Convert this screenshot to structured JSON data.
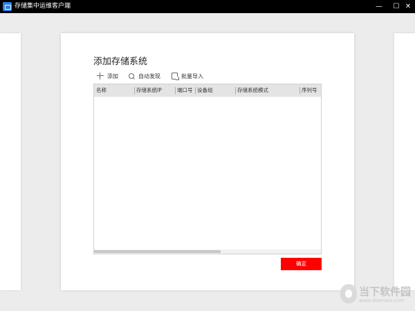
{
  "window": {
    "title": "存储集中运维客户端",
    "min_glyph": "—",
    "max_glyph": "☐",
    "close_glyph": "✕"
  },
  "dialog": {
    "title": "添加存储系统",
    "toolbar": {
      "add_label": "添加",
      "discover_label": "自动发现",
      "import_label": "批量导入"
    },
    "table": {
      "columns": [
        "名称",
        "存储系统IP",
        "端口号",
        "设备组",
        "存储系统模式",
        "序列号"
      ],
      "rows": []
    },
    "confirm_label": "确定"
  },
  "watermark": {
    "text": "当下软件园",
    "url": "www.downxia.com"
  },
  "colors": {
    "accent": "#ff0000",
    "titlebar": "#000000",
    "header_bg": "#e4e4e4"
  }
}
